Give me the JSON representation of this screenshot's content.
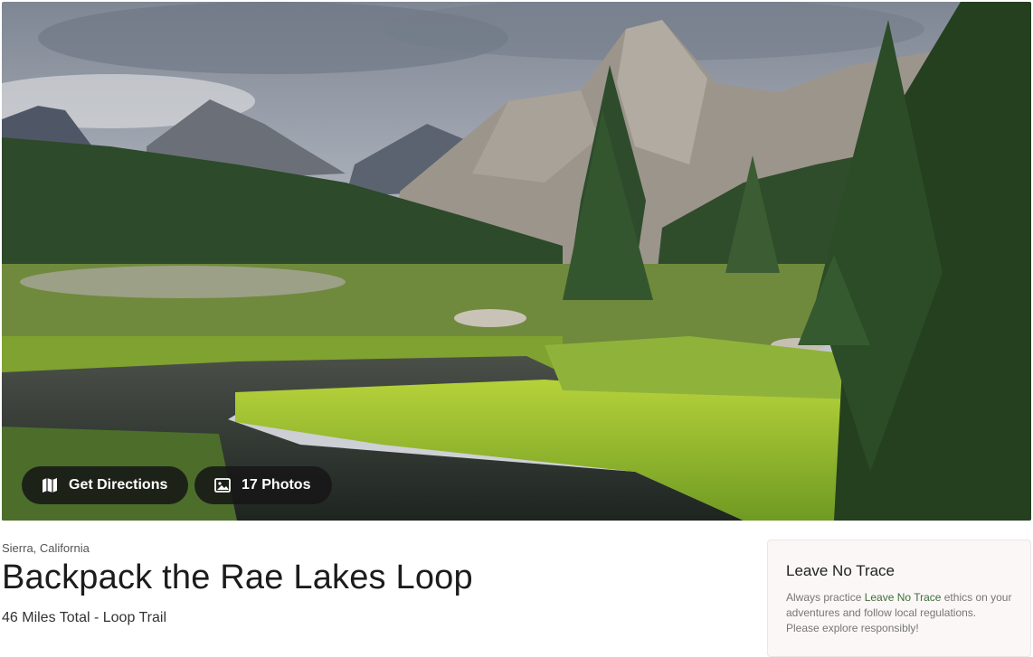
{
  "hero": {
    "directions_label": "Get Directions",
    "directions_icon": "map-icon",
    "photos_label": "17 Photos",
    "photos_icon": "image-icon"
  },
  "trail": {
    "location": "Sierra, California",
    "title": "Backpack the Rae Lakes Loop",
    "subtitle": "46 Miles Total - Loop Trail"
  },
  "notice": {
    "title": "Leave No Trace",
    "body_before": "Always practice ",
    "link_text": "Leave No Trace",
    "body_after": " ethics on your adventures and follow local regulations. Please explore responsibly!"
  },
  "colors": {
    "button_bg": "#161616",
    "link": "#3f6e3a",
    "card_bg": "#faf7f6"
  }
}
